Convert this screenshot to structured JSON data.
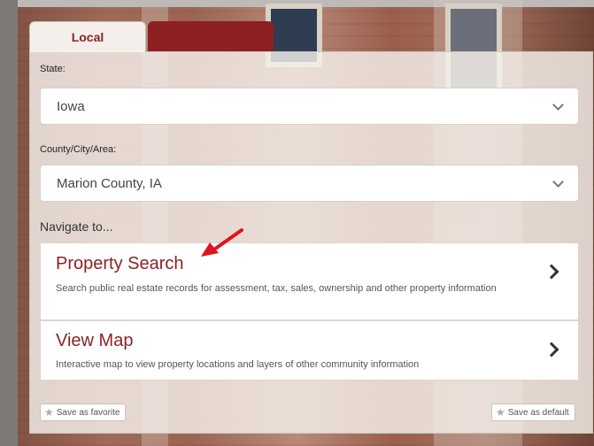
{
  "tabs": [
    {
      "label": "Local"
    },
    {
      "label": ""
    }
  ],
  "state": {
    "label": "State:",
    "value": "Iowa"
  },
  "county": {
    "label": "County/City/Area:",
    "value": "Marion County, IA"
  },
  "navigate": {
    "heading": "Navigate to...",
    "items": [
      {
        "title": "Property Search",
        "desc": "Search public real estate records for assessment, tax, sales, ownership and other property information"
      },
      {
        "title": "View Map",
        "desc": "Interactive map to view property locations and layers of other community information"
      }
    ]
  },
  "buttons": {
    "favorite": "Save as favorite",
    "default": "Save as default"
  },
  "colors": {
    "brand": "#8e1f23",
    "annotation_arrow": "#e0141c"
  },
  "icons": [
    "chevron-down-icon",
    "chevron-right-icon",
    "star-icon"
  ]
}
